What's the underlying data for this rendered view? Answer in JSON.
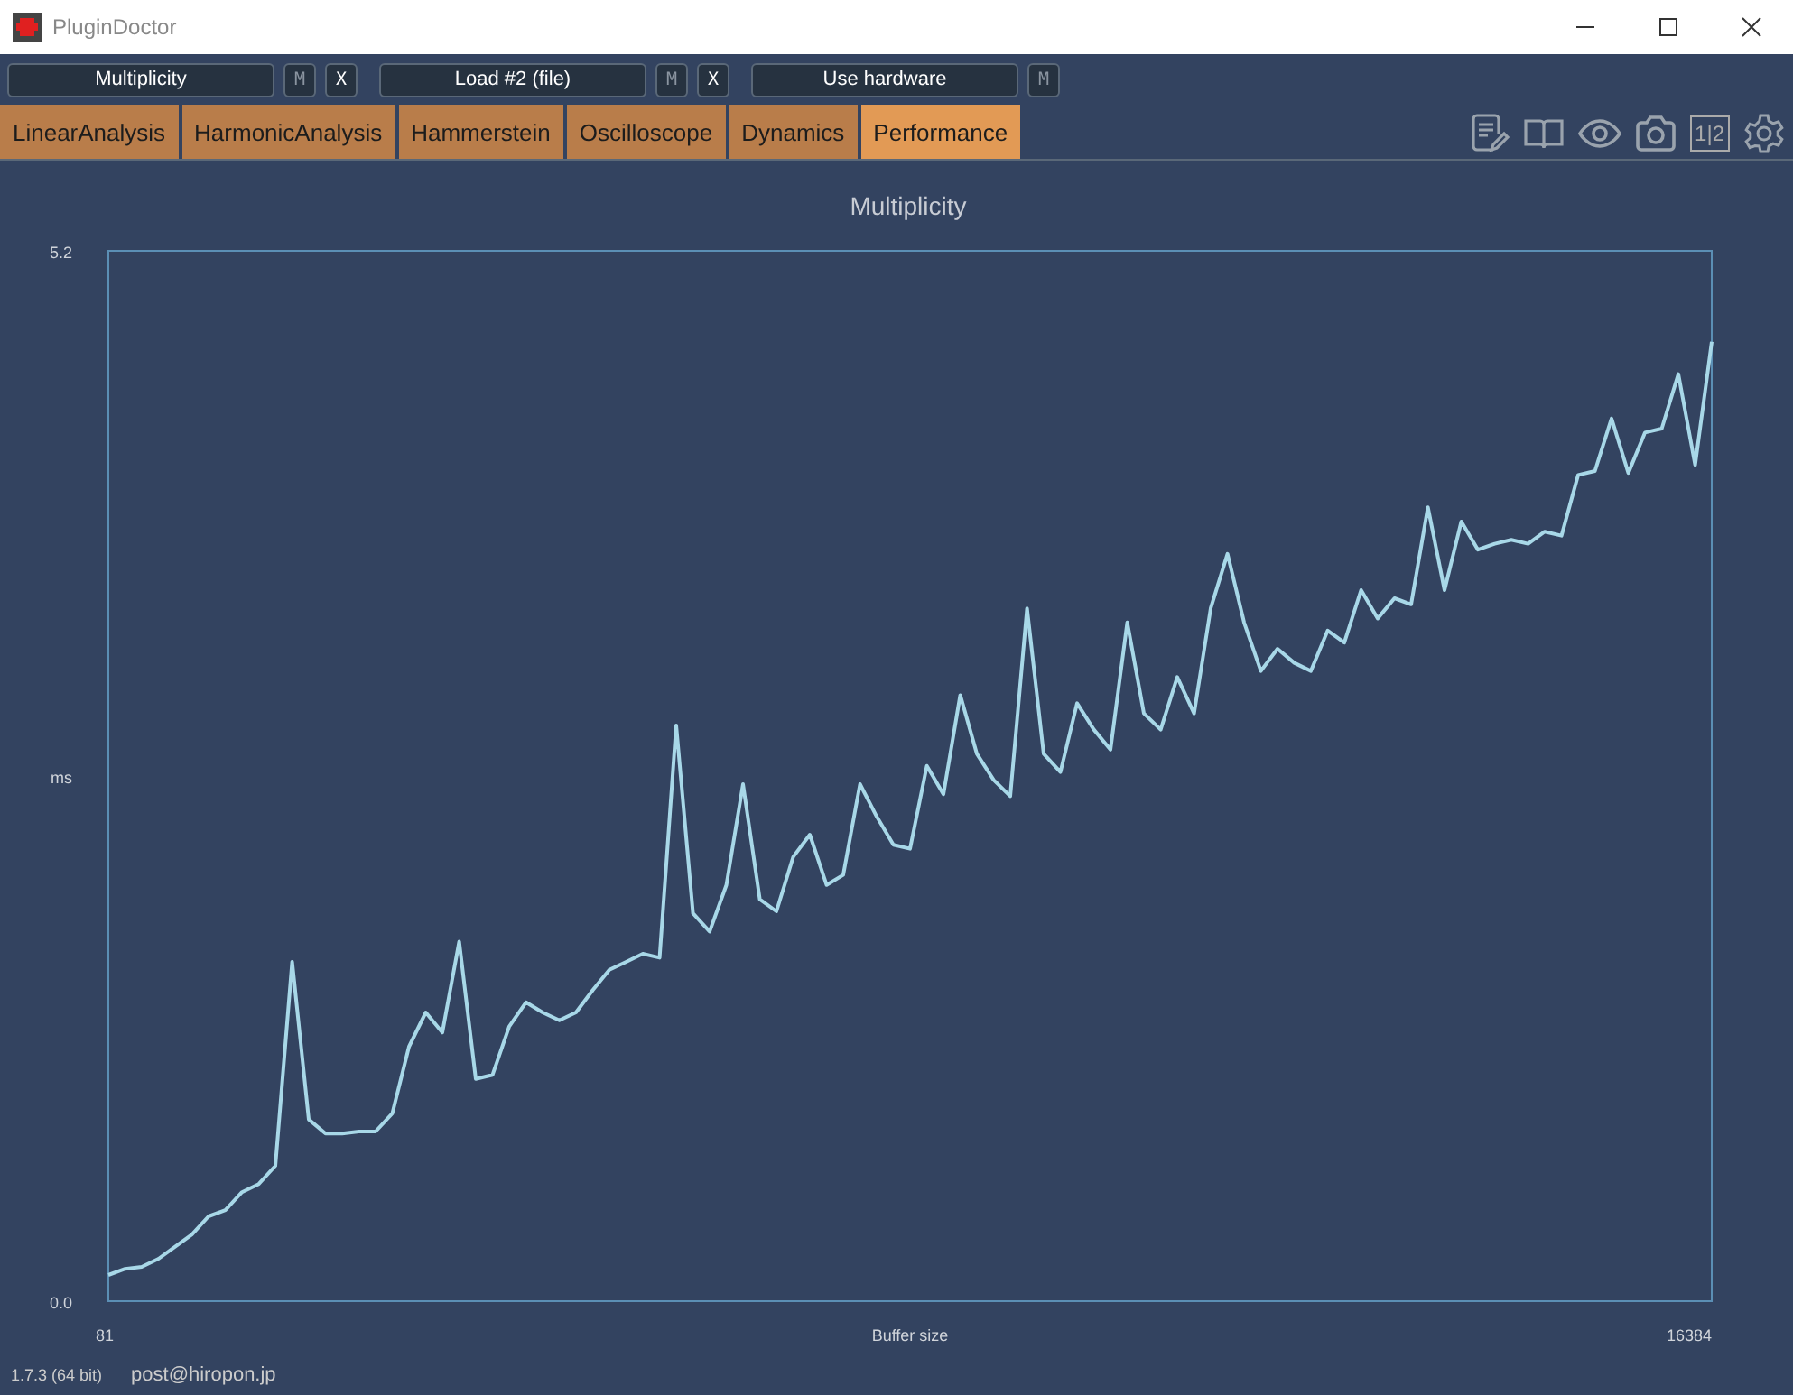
{
  "window": {
    "title": "PluginDoctor"
  },
  "toolbar": [
    {
      "label": "Multiplicity",
      "buttons": [
        {
          "label": "M",
          "disabled": true
        },
        {
          "label": "X",
          "disabled": false
        }
      ]
    },
    {
      "label": "Load #2 (file)",
      "buttons": [
        {
          "label": "M",
          "disabled": true
        },
        {
          "label": "X",
          "disabled": false
        }
      ]
    },
    {
      "label": "Use hardware",
      "buttons": [
        {
          "label": "M",
          "disabled": true
        }
      ]
    }
  ],
  "tabs": [
    {
      "label": "LinearAnalysis",
      "selected": false
    },
    {
      "label": "HarmonicAnalysis",
      "selected": false
    },
    {
      "label": "Hammerstein",
      "selected": false
    },
    {
      "label": "Oscilloscope",
      "selected": false
    },
    {
      "label": "Dynamics",
      "selected": false
    },
    {
      "label": "Performance",
      "selected": true
    }
  ],
  "view_toggle": "1|2",
  "chart": {
    "x_axis_start": "81",
    "x_axis_end": "16384",
    "chart_data": {
      "type": "line",
      "title": "Multiplicity",
      "xlabel": "Buffer size",
      "ylabel": "ms",
      "ylim": [
        0,
        5.2
      ],
      "yticks": [
        {
          "value": 0,
          "label": "0.0"
        },
        {
          "value": 5.2,
          "label": "5.2"
        }
      ],
      "series": [
        {
          "color": "#a8d8e8",
          "values": [
            0.13,
            0.16,
            0.17,
            0.21,
            0.27,
            0.33,
            0.42,
            0.45,
            0.54,
            0.58,
            0.67,
            1.68,
            0.9,
            0.83,
            0.83,
            0.84,
            0.84,
            0.93,
            1.26,
            1.43,
            1.33,
            1.78,
            1.1,
            1.12,
            1.36,
            1.48,
            1.43,
            1.39,
            1.43,
            1.54,
            1.64,
            1.68,
            1.72,
            1.7,
            2.85,
            1.92,
            1.83,
            2.06,
            2.56,
            1.99,
            1.93,
            2.2,
            2.31,
            2.06,
            2.11,
            2.56,
            2.4,
            2.26,
            2.24,
            2.65,
            2.51,
            3.0,
            2.71,
            2.58,
            2.5,
            3.43,
            2.71,
            2.62,
            2.96,
            2.83,
            2.73,
            3.36,
            2.91,
            2.83,
            3.09,
            2.91,
            3.43,
            3.7,
            3.36,
            3.12,
            3.23,
            3.16,
            3.12,
            3.32,
            3.26,
            3.52,
            3.38,
            3.48,
            3.45,
            3.93,
            3.52,
            3.86,
            3.72,
            3.75,
            3.77,
            3.75,
            3.81,
            3.79,
            4.09,
            4.11,
            4.37,
            4.1,
            4.3,
            4.32,
            4.59,
            4.14,
            4.75
          ]
        }
      ]
    }
  },
  "status_bar": {
    "version": "1.7.3 (64 bit)",
    "email": "post@hiropon.jp"
  }
}
